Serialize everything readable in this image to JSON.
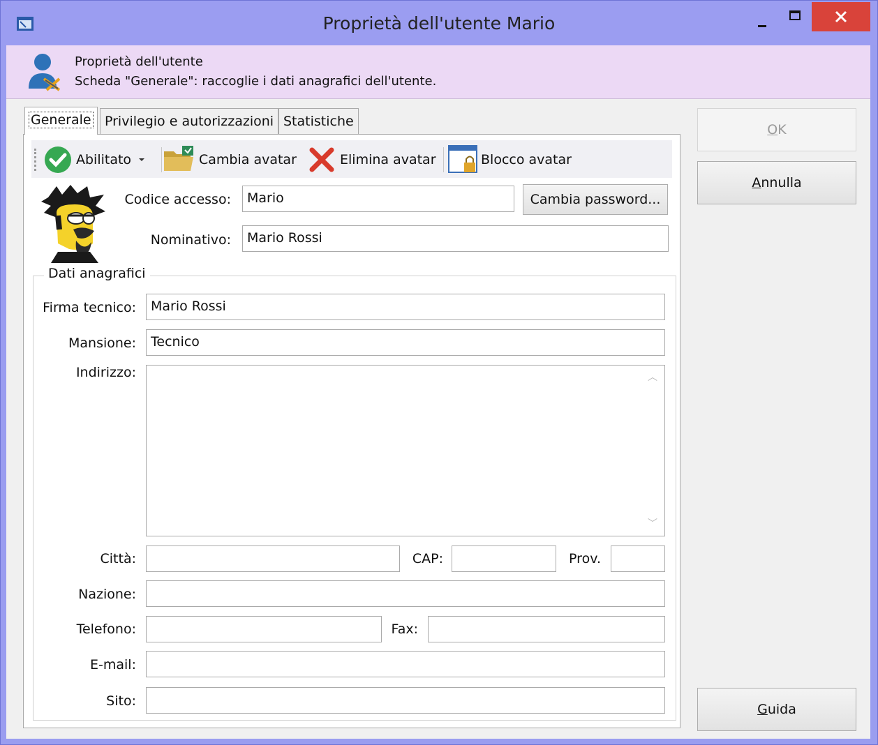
{
  "window": {
    "title": "Proprietà dell'utente Mario"
  },
  "header": {
    "title": "Proprietà dell'utente",
    "description": "Scheda \"Generale\": raccoglie i dati anagrafici dell'utente."
  },
  "tabs": [
    {
      "label": "Generale",
      "active": true
    },
    {
      "label": "Privilegio e autorizzazioni",
      "active": false
    },
    {
      "label": "Statistiche",
      "active": false
    }
  ],
  "toolbar": {
    "enabled_label": "Abilitato",
    "change_avatar_label": "Cambia avatar",
    "delete_avatar_label": "Elimina avatar",
    "lock_avatar_label": "Blocco avatar"
  },
  "account": {
    "access_code_label": "Codice accesso:",
    "access_code_value": "Mario",
    "change_password_label": "Cambia password...",
    "name_label": "Nominativo:",
    "name_value": "Mario Rossi"
  },
  "personal": {
    "group_title": "Dati anagrafici",
    "signature_label": "Firma tecnico:",
    "signature_value": "Mario Rossi",
    "role_label": "Mansione:",
    "role_value": "Tecnico",
    "address_label": "Indirizzo:",
    "address_value": "",
    "city_label": "Città:",
    "city_value": "",
    "zip_label": "CAP:",
    "zip_value": "",
    "province_label": "Prov.",
    "province_value": "",
    "country_label": "Nazione:",
    "country_value": "",
    "phone_label": "Telefono:",
    "phone_value": "",
    "fax_label": "Fax:",
    "fax_value": "",
    "email_label": "E-mail:",
    "email_value": "",
    "site_label": "Sito:",
    "site_value": ""
  },
  "buttons": {
    "ok_mnemonic": "O",
    "ok_rest": "K",
    "cancel_mnemonic": "A",
    "cancel_rest": "nnulla",
    "help_mnemonic": "G",
    "help_rest": "uida"
  },
  "colors": {
    "titlebar": "#9b9df1",
    "header": "#ecd9f5",
    "close": "#d9433a",
    "enabled_icon": "#36a852",
    "delete_icon": "#d83b2c"
  },
  "icons": {
    "app": "window-icon",
    "header": "user-settings-icon",
    "enabled": "check-circle-icon",
    "change_avatar": "folder-icon",
    "delete_avatar": "x-icon",
    "lock_avatar": "lock-window-icon"
  }
}
